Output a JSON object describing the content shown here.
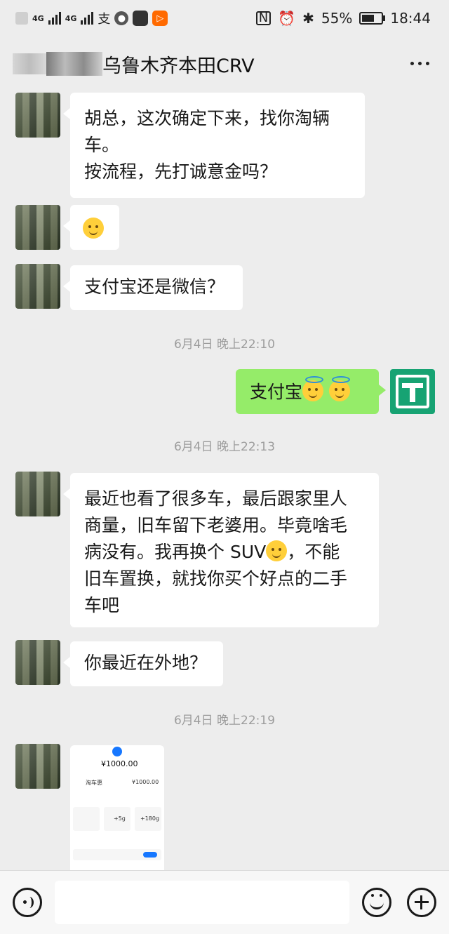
{
  "status_bar": {
    "network_1": "4G",
    "network_2": "4G",
    "alipay_glyph": "支",
    "battery_percent": "55%",
    "clock": "18:44",
    "icons": [
      "nfc-icon",
      "alarm-icon",
      "bluetooth-icon",
      "battery-icon"
    ]
  },
  "header": {
    "title": "乌鲁木齐本田CRV",
    "more_icon": "more-icon"
  },
  "messages": [
    {
      "side": "left",
      "type": "text",
      "lines": [
        "胡总，这次确定下来，找你淘辆",
        "车。",
        "按流程，先打诚意金吗？"
      ]
    },
    {
      "side": "left",
      "type": "emoji",
      "emoji": "smile"
    },
    {
      "side": "left",
      "type": "text",
      "lines": [
        "支付宝还是微信？"
      ]
    },
    {
      "type": "time",
      "text": "6月4日 晚上22:10"
    },
    {
      "side": "right",
      "type": "text",
      "text": "支付宝"
    },
    {
      "type": "time",
      "text": "6月4日 晚上22:13"
    },
    {
      "side": "left",
      "type": "text",
      "lines": [
        "最近也看了很多车，最后跟家里人",
        "商量，旧车留下老婆用。毕竟啥毛",
        "病没有。我再换个 SUV",
        "，不能",
        "旧车置换，就找你买个好点的二手",
        "车吧"
      ]
    },
    {
      "side": "left",
      "type": "text",
      "lines": [
        "你最近在外地？"
      ]
    },
    {
      "type": "time",
      "text": "6月4日 晚上22:19"
    },
    {
      "side": "left",
      "type": "image",
      "receipt": {
        "amount": "¥1000.00",
        "amount_small": "¥1000.00",
        "payee": "淘车惠",
        "points": "+5g",
        "points2": "+180g"
      }
    }
  ],
  "input_bar": {
    "voice_icon": "voice-icon",
    "emoji_icon": "emoji-icon",
    "plus_icon": "plus-icon",
    "value": ""
  }
}
